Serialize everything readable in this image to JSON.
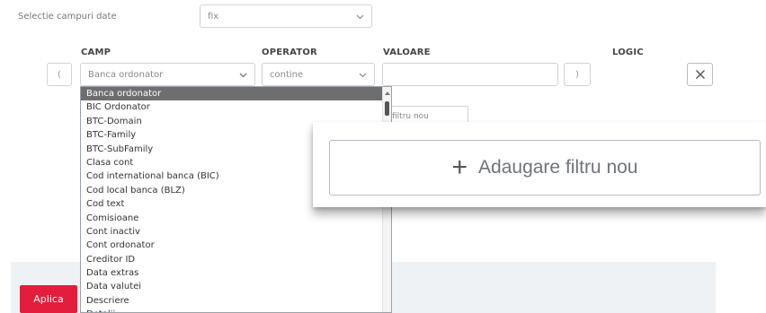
{
  "top": {
    "selection_label": "Selectie campuri date",
    "selection_value": "fix"
  },
  "headers": {
    "camp": "CAMP",
    "operator": "OPERATOR",
    "valoare": "VALOARE",
    "logic": "LOGIC"
  },
  "row": {
    "open_paren": "(",
    "camp_value": "Banca ordonator",
    "operator_value": "contine",
    "valoare_value": "",
    "close_paren": ")"
  },
  "small_add_label": "filtru nou",
  "big_add_label": "Adaugare filtru nou",
  "aplica_label": "Aplica",
  "dropdown_items": [
    "Banca ordonator",
    "BIC Ordonator",
    "BTC-Domain",
    "BTC-Family",
    "BTC-SubFamily",
    "Clasa cont",
    "Cod international banca (BIC)",
    "Cod local banca (BLZ)",
    "Cod text",
    "Comisioane",
    "Cont inactiv",
    "Cont ordonator",
    "Creditor ID",
    "Data extras",
    "Data valutei",
    "Descriere",
    "Detalii"
  ],
  "colors": {
    "accent_red": "#e31d3b",
    "selected_item_bg": "#6e6e6e",
    "panel_bg": "#eef2f4"
  }
}
